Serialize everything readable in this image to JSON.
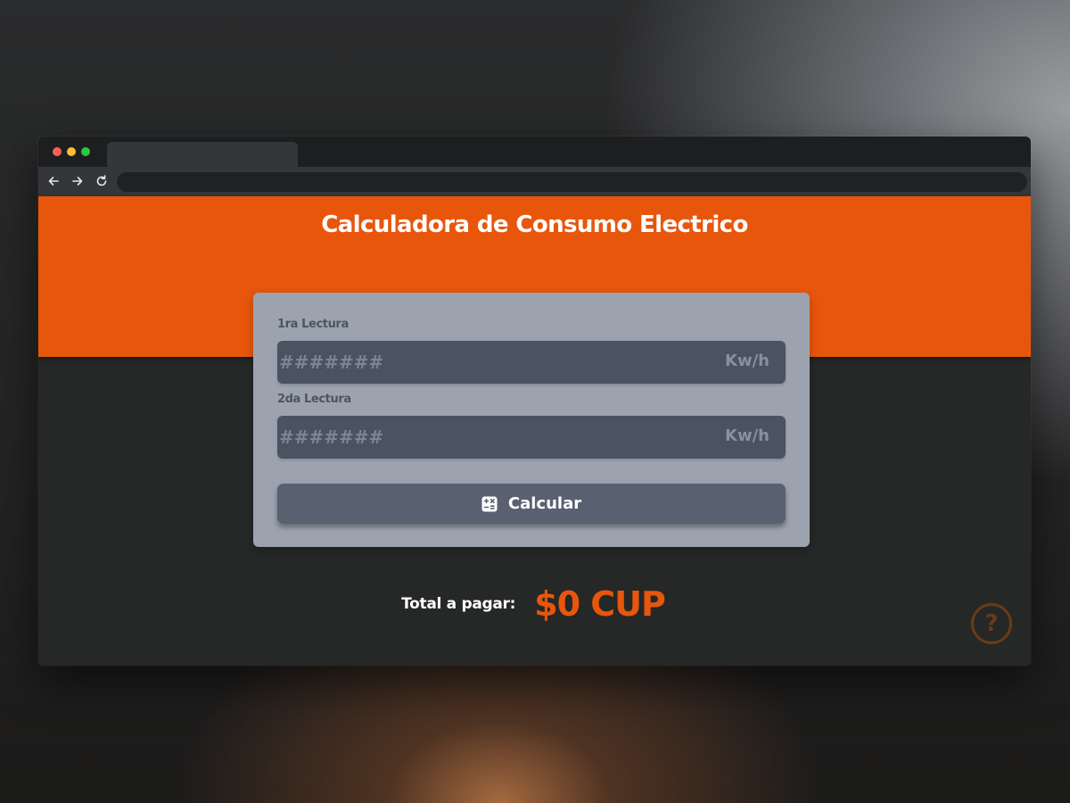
{
  "browser": {
    "back_icon": "arrow-left-icon",
    "forward_icon": "arrow-right-icon",
    "reload_icon": "reload-icon"
  },
  "header": {
    "title": "Calculadora de Consumo Electrico"
  },
  "form": {
    "reading1": {
      "label": "1ra Lectura",
      "placeholder": "#######",
      "value": "",
      "unit": "Kw/h"
    },
    "reading2": {
      "label": "2da Lectura",
      "placeholder": "#######",
      "value": "",
      "unit": "Kw/h"
    },
    "calculate_button": {
      "label": "Calcular",
      "icon": "calculator-icon"
    }
  },
  "result": {
    "label": "Total a pagar:",
    "value": "$0 CUP"
  },
  "help": {
    "icon": "question-mark-icon",
    "glyph": "?"
  },
  "colors": {
    "accent": "#e8560c",
    "card": "#9ca3af",
    "input": "#4b5261",
    "button": "#596070",
    "background": "#262727"
  }
}
